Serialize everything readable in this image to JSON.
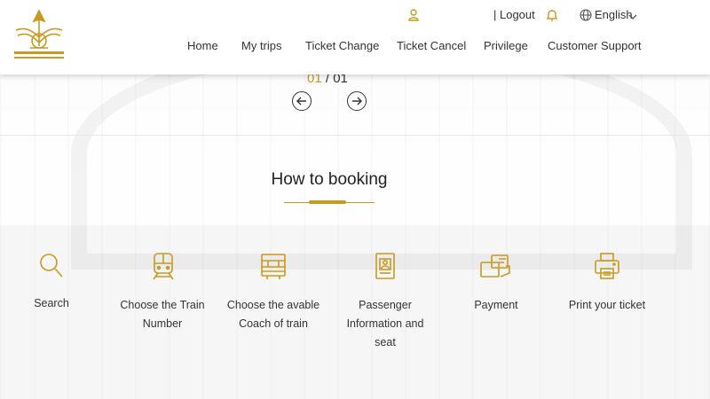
{
  "header": {
    "logo_alt": "State Railway of Thailand",
    "logout": "| Logout",
    "language": "English",
    "nav": [
      "Home",
      "My trips",
      "Ticket Change",
      "Ticket Cancel",
      "Privilege",
      "Customer Support"
    ]
  },
  "slider": {
    "current": "01",
    "separator": " / ",
    "total": "01"
  },
  "section": {
    "title": "How to booking"
  },
  "steps": [
    {
      "label": "Search",
      "icon": "search-icon"
    },
    {
      "label": "Choose the Train Number",
      "icon": "train-icon"
    },
    {
      "label": "Choose the avable Coach of train",
      "icon": "coach-icon"
    },
    {
      "label": "Passenger Information and seat",
      "icon": "passenger-icon"
    },
    {
      "label": "Payment",
      "icon": "payment-icon"
    },
    {
      "label": "Print your ticket",
      "icon": "printer-icon"
    }
  ],
  "colors": {
    "accent": "#c89a21",
    "text": "#333333"
  }
}
